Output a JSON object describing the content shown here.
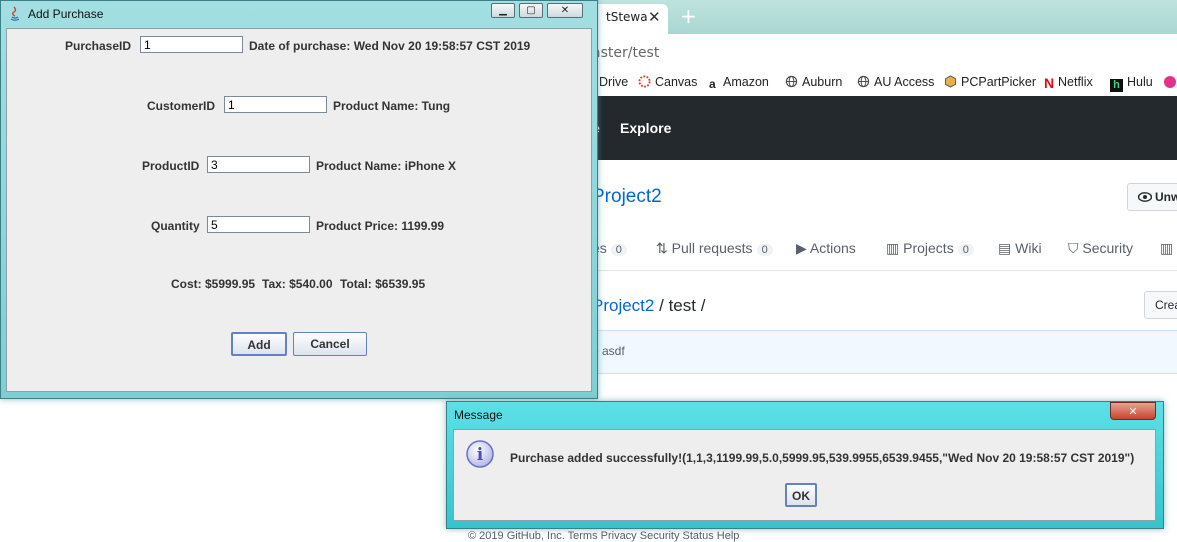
{
  "browser": {
    "tab_title": "tStewa",
    "tab_close": "✕",
    "new_tab": "+",
    "url": "aster/test",
    "bookmarks": [
      "Drive",
      "Canvas",
      "Amazon",
      "Auburn",
      "AU Access",
      "PCPartPicker",
      "Netflix",
      "Hulu"
    ],
    "nav": {
      "partial": "e",
      "explore": "Explore"
    },
    "repo_name": "Project2",
    "unwatch_label": "Unw",
    "tabs": [
      {
        "label": "es",
        "count": "0"
      },
      {
        "label": "Pull requests",
        "count": "0"
      },
      {
        "label": "Actions"
      },
      {
        "label": "Projects",
        "count": "0"
      },
      {
        "label": "Wiki"
      },
      {
        "label": "Security"
      }
    ],
    "path": {
      "repo": "Project2",
      "sep1": "/",
      "folder": "test",
      "sep2": "/"
    },
    "create_label": "Crea",
    "commit_message": "e asdf",
    "footer": "© 2019 GitHub, Inc.   Terms   Privacy   Security   Status   Help"
  },
  "add_purchase": {
    "title": "Add Purchase",
    "purchase_id_label": "PurchaseID",
    "purchase_id_value": "1",
    "date_of_purchase": "Date of purchase: Wed Nov 20 19:58:57 CST 2019",
    "customer_id_label": "CustomerID",
    "customer_id_value": "1",
    "customer_name": "Product Name: Tung",
    "product_id_label": "ProductID",
    "product_id_value": "3",
    "product_name": "Product Name: iPhone X",
    "quantity_label": "Quantity",
    "quantity_value": "5",
    "product_price": "Product Price: 1199.99",
    "cost": "Cost: $5999.95",
    "tax": "Tax: $540.00",
    "total": "Total: $6539.95",
    "add_label": "Add",
    "cancel_label": "Cancel"
  },
  "message_dialog": {
    "title": "Message",
    "text": "Purchase added successfully!(1,1,3,1199.99,5.0,5999.95,539.9955,6539.9455,\"Wed Nov 20 19:58:57 CST 2019\")",
    "ok_label": "OK",
    "close_label": "✕"
  },
  "colors": {
    "accent": "#0366d6",
    "titlebar": "#7ecfd3",
    "github_header": "#24292e"
  }
}
